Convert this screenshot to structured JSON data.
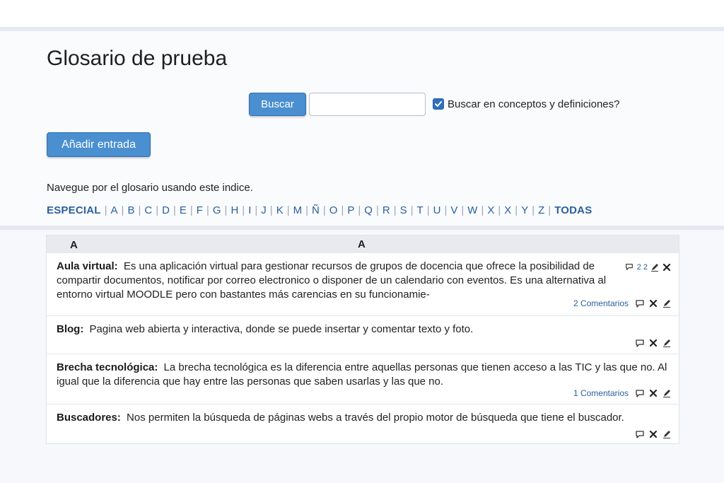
{
  "page": {
    "title": "Glosario de prueba"
  },
  "search": {
    "button_label": "Buscar",
    "input_value": "",
    "checkbox_checked": true,
    "checkbox_label": "Buscar en conceptos y definiciones?"
  },
  "add_entry": {
    "button_label": "Añadir entrada"
  },
  "browse": {
    "text": "Navegue por el glosario usando este indice.",
    "special_label": "ESPECIAL",
    "all_label": "TODAS",
    "letters": [
      "A",
      "B",
      "C",
      "D",
      "E",
      "F",
      "G",
      "H",
      "I",
      "J",
      "K",
      "M",
      "Ñ",
      "O",
      "P",
      "Q",
      "R",
      "S",
      "T",
      "U",
      "V",
      "W",
      "X",
      "X",
      "Y",
      "Z"
    ]
  },
  "table": {
    "header_left": "A",
    "header_center": "A",
    "entries": [
      {
        "concept": "Aula virtual:",
        "definition": "Es una aplicación virtual para gestionar recursos de grupos de docencia que ofrece la posibilidad de compartir documentos, notificar por correo electronico o disponer de un calendario con eventos. Es una alternativa al entorno virtual MOODLE pero con bastantes más carencias en su funcionamie-",
        "top_counts": "2 2",
        "comments_label": "2 Comentarios"
      },
      {
        "concept": "Blog:",
        "definition": "Pagina web abierta y interactiva, donde se puede insertar y comentar texto y foto.",
        "comments_label": ""
      },
      {
        "concept": "Brecha tecnológica:",
        "definition": "La brecha tecnológica es la diferencia entre aquellas personas que tienen acceso a las TIC y las que no. Al igual que la diferencia que hay entre las personas que saben usarlas y las que no.",
        "comments_label": "1 Comentarios"
      },
      {
        "concept": "Buscadores:",
        "definition": "Nos permiten la búsqueda de páginas webs a través del propio motor de búsqueda que tiene el buscador.",
        "comments_label": ""
      }
    ]
  },
  "colors": {
    "accent": "#4a8fd0",
    "link": "#2b5f9e",
    "header_bg": "#e8eaf0"
  },
  "icons": [
    "comment-icon",
    "delete-icon",
    "edit-icon",
    "check-icon"
  ]
}
